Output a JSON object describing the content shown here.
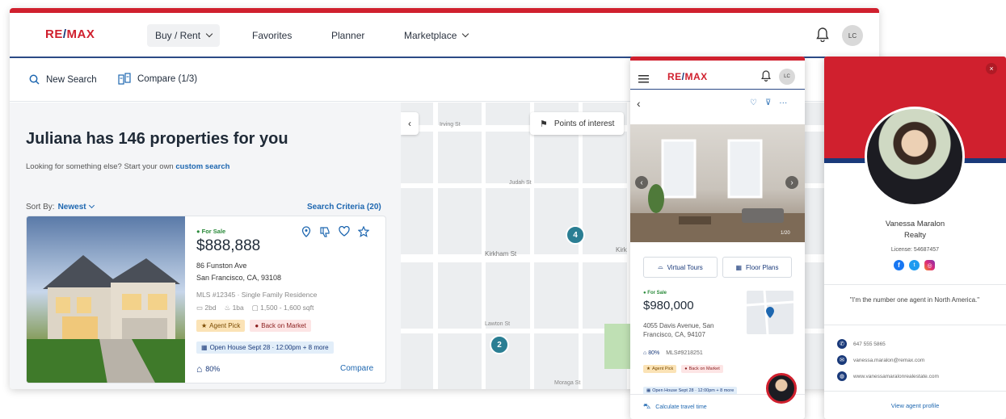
{
  "brand": {
    "re": "RE",
    "slash": "/",
    "max": "MAX"
  },
  "nav": {
    "items": [
      {
        "label": "Buy / Rent"
      },
      {
        "label": "Favorites"
      },
      {
        "label": "Planner"
      },
      {
        "label": "Marketplace"
      }
    ],
    "avatar_initials": "LC"
  },
  "subbar": {
    "new_search": "New Search",
    "compare": "Compare (1/3)"
  },
  "results": {
    "heading": "Juliana has 146 properties for you",
    "subtext": "Looking for something else? Start your own",
    "custom_search": "custom search",
    "sort_label": "Sort By:",
    "sort_value": "Newest",
    "criteria": "Search Criteria (20)"
  },
  "listing": {
    "status": "For Sale",
    "price": "$888,888",
    "address1": "86 Funston Ave",
    "address2": "San Francisco, CA, 93108",
    "mls": "MLS #12345 · Single Family Residence",
    "beds": "2bd",
    "baths": "1ba",
    "sqft": "1,500 - 1,600 sqft",
    "tag_agent": "Agent Pick",
    "tag_market": "Back on Market",
    "open_house": "Open House Sept 28 · 12:00pm + 8 more",
    "score": "80%",
    "compare": "Compare"
  },
  "map": {
    "poi": "Points of interest",
    "streets": [
      "Irving St",
      "Judah St",
      "Kirkham St",
      "Lawton St",
      "Moraga St",
      "Kirk"
    ],
    "cluster_a": "4",
    "cluster_b": "2"
  },
  "mobile": {
    "avatar_initials": "LC",
    "photo_count": "1/20",
    "virtual_tours": "Virtual Tours",
    "floor_plans": "Floor Plans",
    "status": "For Sale",
    "price": "$980,000",
    "address": "4055 Davis Avenue, San Francisco, CA, 94107",
    "score": "80%",
    "mls": "MLS#9218251",
    "tag_agent": "Agent Pick",
    "tag_market": "Back on Market",
    "open_house": "Open House Sept 28 · 12:00pm + 8 more",
    "travel": "Calculate travel time"
  },
  "agent": {
    "name": "Vanessa Maralon",
    "company": "Realty",
    "license": "License: 54687457",
    "quote": "\"I'm the number one agent in North America.\"",
    "phone": "647 555 5865",
    "email": "vanessa.maralon@remax.com",
    "website": "www.vanessamaralonrealestate.com",
    "profile_link": "View agent profile"
  },
  "colors": {
    "brand_red": "#d0202e",
    "brand_blue": "#1a3a7a",
    "link_blue": "#1e67b0",
    "teal_cluster": "#2a7e93"
  }
}
